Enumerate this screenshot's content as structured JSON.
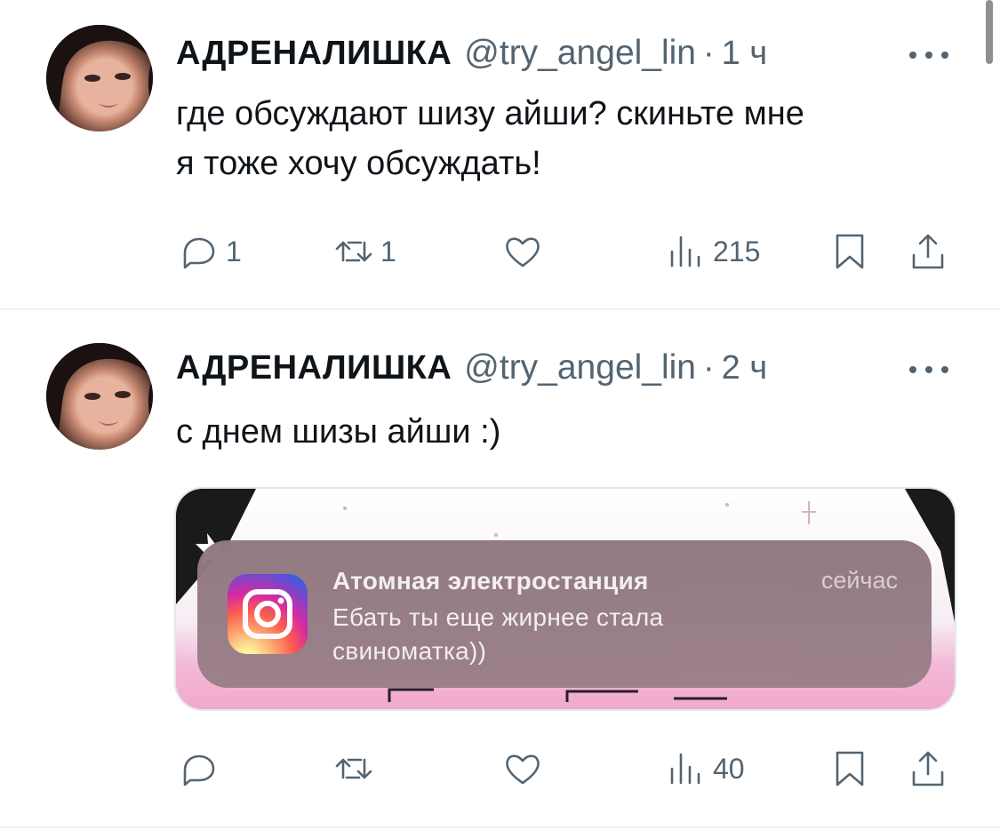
{
  "tweets": [
    {
      "author": "АДРЕНАЛИШКА",
      "handle": "@try_angel_lin",
      "separator": "·",
      "time": "1 ч",
      "text": "где обсуждают шизу айши? скиньте мне\nя тоже хочу обсуждать!",
      "replies": "1",
      "retweets": "1",
      "views": "215"
    },
    {
      "author": "АДРЕНАЛИШКА",
      "handle": "@try_angel_lin",
      "separator": "·",
      "time": "2 ч",
      "text": "с днем шизы айши :)",
      "views": "40",
      "media": {
        "notification": {
          "app_icon": "instagram-icon",
          "title": "Атомная электростанция",
          "time": "сейчас",
          "body": "Ебать ты еще жирнее стала\nсвиноматка))"
        }
      }
    }
  ],
  "icons": {
    "reply": "reply-icon",
    "retweet": "retweet-icon",
    "like": "heart-icon",
    "views": "views-icon",
    "bookmark": "bookmark-icon",
    "share": "share-icon",
    "more": "more-icon"
  },
  "colors": {
    "text": "#0f1419",
    "secondary": "#536471",
    "divider": "#eff3f4"
  }
}
